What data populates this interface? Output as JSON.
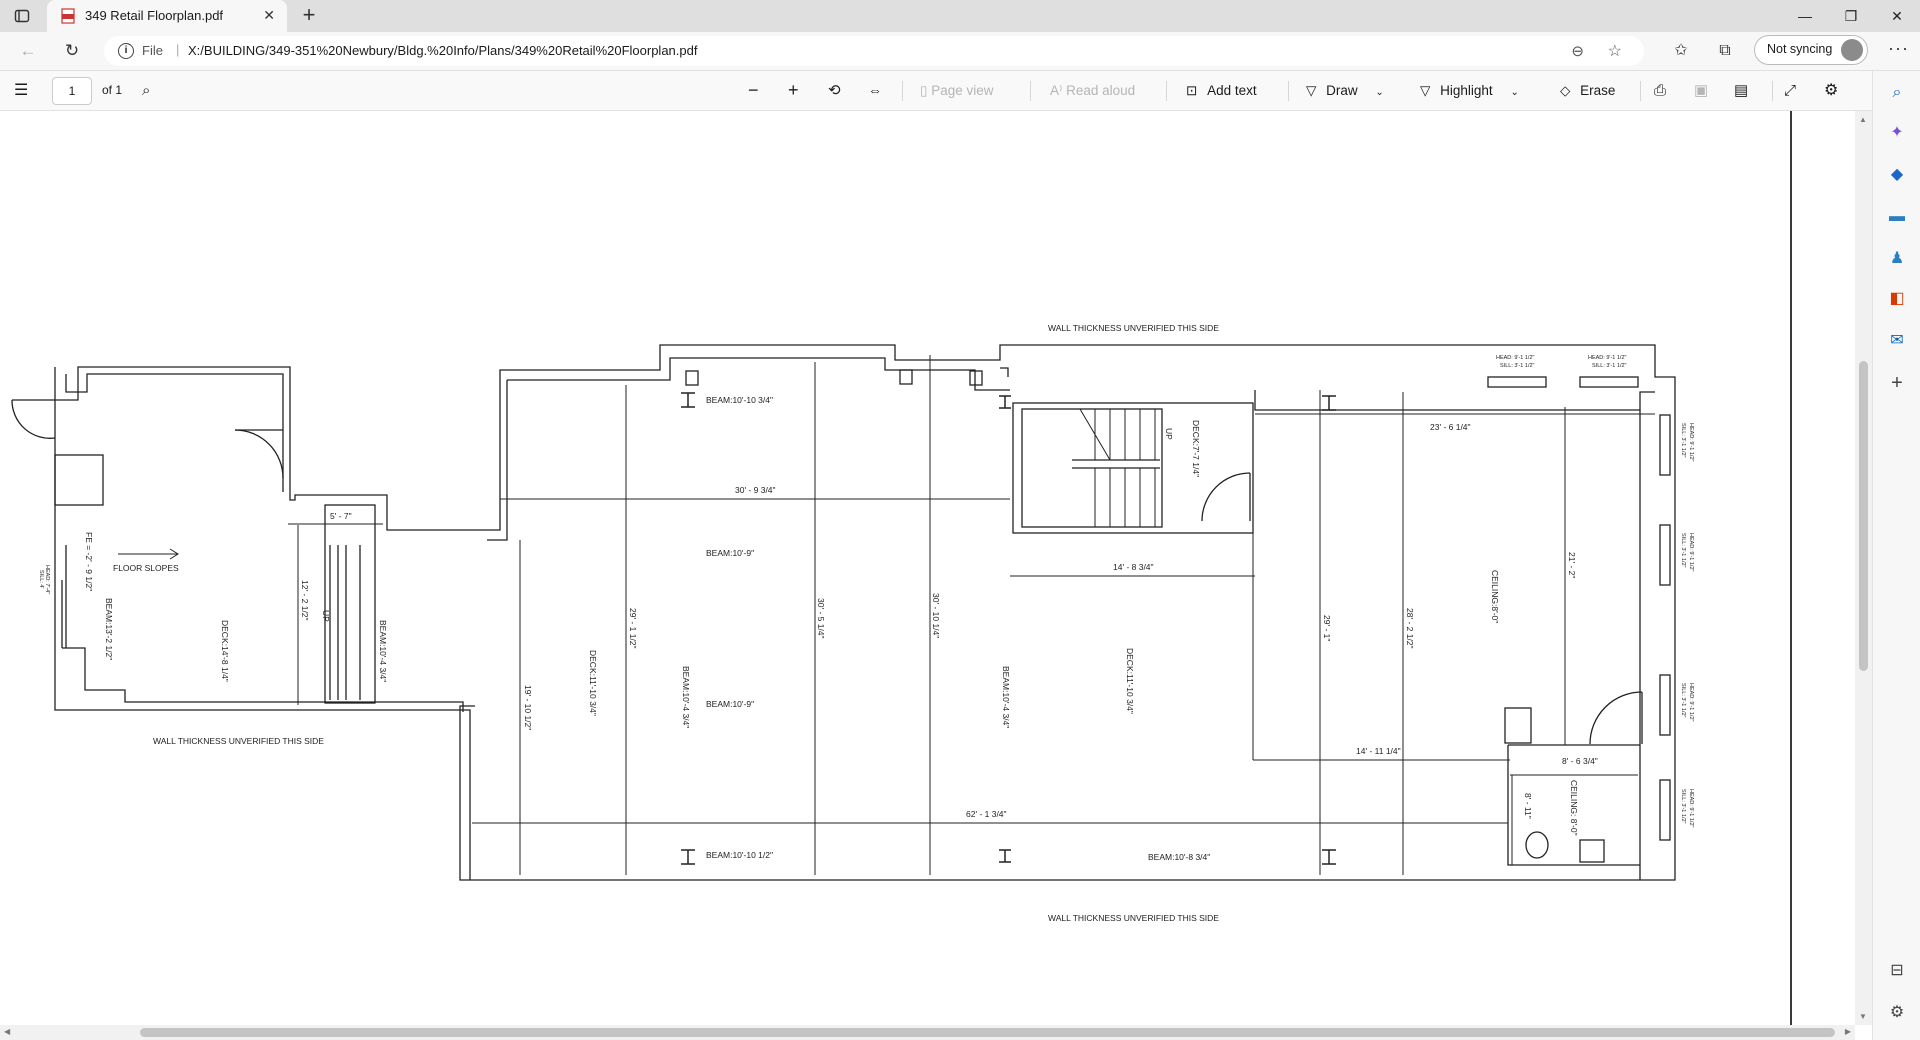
{
  "tab": {
    "title": "349 Retail Floorplan.pdf"
  },
  "address": {
    "protocol": "File",
    "path": "X:/BUILDING/349-351%20Newbury/Bldg.%20Info/Plans/349%20Retail%20Floorplan.pdf"
  },
  "sync": {
    "label": "Not syncing"
  },
  "pdf_toolbar": {
    "page_number": "1",
    "page_total": "of 1",
    "page_view": "Page view",
    "read_aloud": "Read aloud",
    "add_text": "Add text",
    "draw": "Draw",
    "highlight": "Highlight",
    "erase": "Erase"
  },
  "drawing": {
    "wall_note_top": "WALL THICKNESS UNVERIFIED THIS SIDE",
    "wall_note_left": "WALL THICKNESS UNVERIFIED THIS SIDE",
    "wall_note_bottom": "WALL THICKNESS UNVERIFIED THIS SIDE",
    "floor_slopes": "FLOOR SLOPES",
    "beam_top_1": "BEAM:10'-10 3/4\"",
    "beam_mid_1": "BEAM:10'-9\"",
    "beam_mid_2": "BEAM:10'-9\"",
    "beam_bot_1": "BEAM:10'-10 1/2\"",
    "beam_bot_2": "BEAM:10'-8 3/4\"",
    "dim_30_9": "30' - 9 3/4\"",
    "dim_5_7": "5' - 7\"",
    "dim_14_8": "14' - 8 3/4\"",
    "dim_23_6": "23' - 6 1/4\"",
    "dim_14_11": "14' - 11 1/4\"",
    "dim_8_6": "8' - 6 3/4\"",
    "dim_62_1": "62' - 1 3/4\"",
    "v_fe": "FE = -2' - 9 1/2\"",
    "v_beam_13": "BEAM:13'-2 1/2\"",
    "v_deck_14": "DECK:14'-8 1/4\"",
    "v_12_2": "12' - 2 1/2\"",
    "v_up1": "UP",
    "v_beam_10_4a": "BEAM:10'-4 3/4\"",
    "v_19_10": "19' - 10 1/2\"",
    "v_deck_11a": "DECK:11'-10 3/4\"",
    "v_29_1a": "29' - 1 1/2\"",
    "v_beam_10_4b": "BEAM:10'-4 3/4\"",
    "v_30_5": "30' - 5 1/4\"",
    "v_30_10": "30' - 10 1/4\"",
    "v_beam_10_4c": "BEAM:10'-4 3/4\"",
    "v_deck_11b": "DECK:11'-10 3/4\"",
    "v_up2": "UP",
    "v_deck_7": "DECK:7'-7 1/4\"",
    "v_29_1b": "29' - 1\"",
    "v_28_2": "28' - 2 1/2\"",
    "v_ceiling_1": "CEILING:8'-0\"",
    "v_21_2": "21' - 2\"",
    "v_8_11": "8' - 11\"",
    "v_ceiling_2": "CEILING: 8'-0\"",
    "head_1a": "HEAD: 9'-1 1/2\"",
    "sill_1a": "SILL: 3'-1 1/2\"",
    "head_1b": "HEAD: 9'-1 1/2\"",
    "sill_1b": "SILL: 3'-1 1/2\"",
    "head_r1": "HEAD: 9'-1 1/2\"",
    "sill_r1": "SILL: 3'-1 1/2\"",
    "head_r2": "HEAD: 9'-1 1/2\"",
    "sill_r2": "SILL: 3'-1 1/2\"",
    "head_r3": "HEAD: 9'-1 1/2\"",
    "sill_r3": "SILL: 3'-1 1/2\"",
    "head_r4": "HEAD: 9'-1 1/2\"",
    "sill_r4": "SILL: 3'-1 1/2\"",
    "head_l": "HEAD: 7'-4\"",
    "sill_l": "SILL: 4'"
  }
}
